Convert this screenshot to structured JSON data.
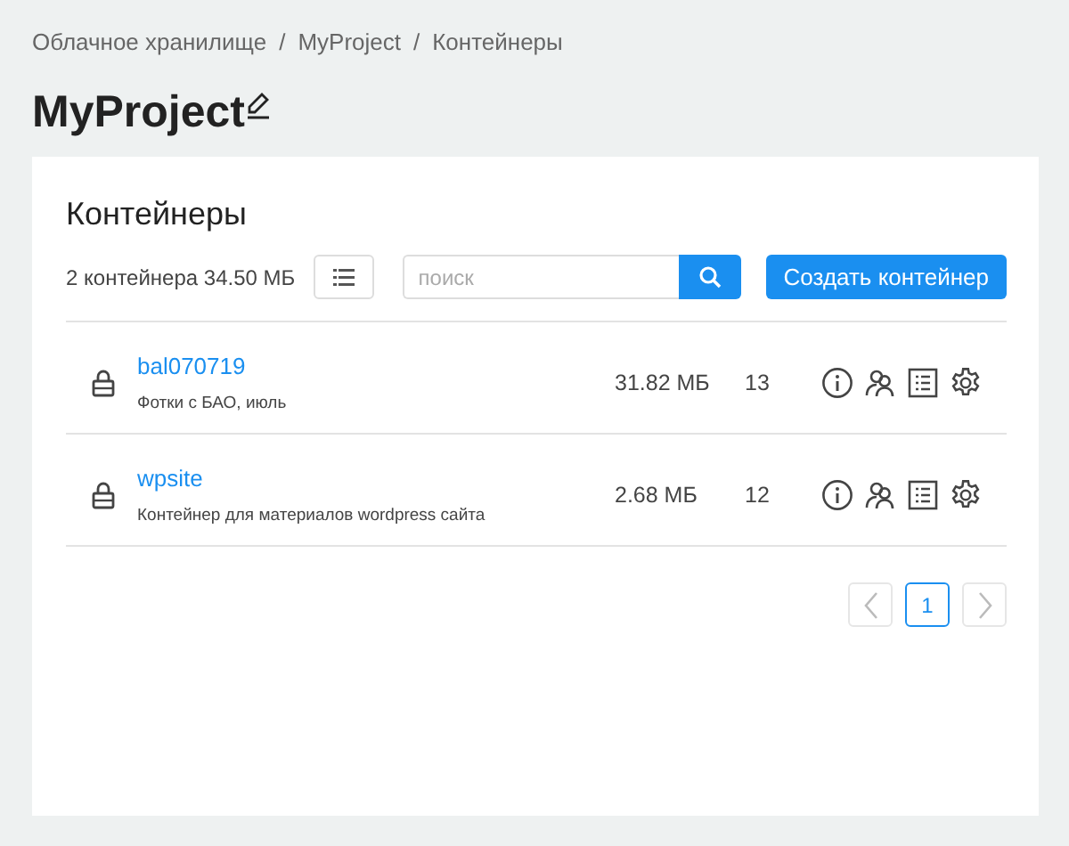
{
  "breadcrumbs": [
    "Облачное хранилище",
    "MyProject",
    "Контейнеры"
  ],
  "breadcrumb_separator": "/",
  "title": "MyProject",
  "panel": {
    "heading": "Контейнеры",
    "summary": "2 контейнера 34.50 МБ",
    "search": {
      "placeholder": "поиск"
    },
    "create_button": "Создать контейнер"
  },
  "containers": [
    {
      "name": "bal070719",
      "description": "Фотки с БАО, июль",
      "size": "31.82 МБ",
      "objects": "13"
    },
    {
      "name": "wpsite",
      "description": "Контейнер для материалов wordpress сайта",
      "size": "2.68 МБ",
      "objects": "12"
    }
  ],
  "pagination": {
    "prev_disabled": true,
    "next_disabled": true,
    "pages": [
      {
        "label": "1",
        "selected": true
      }
    ]
  }
}
